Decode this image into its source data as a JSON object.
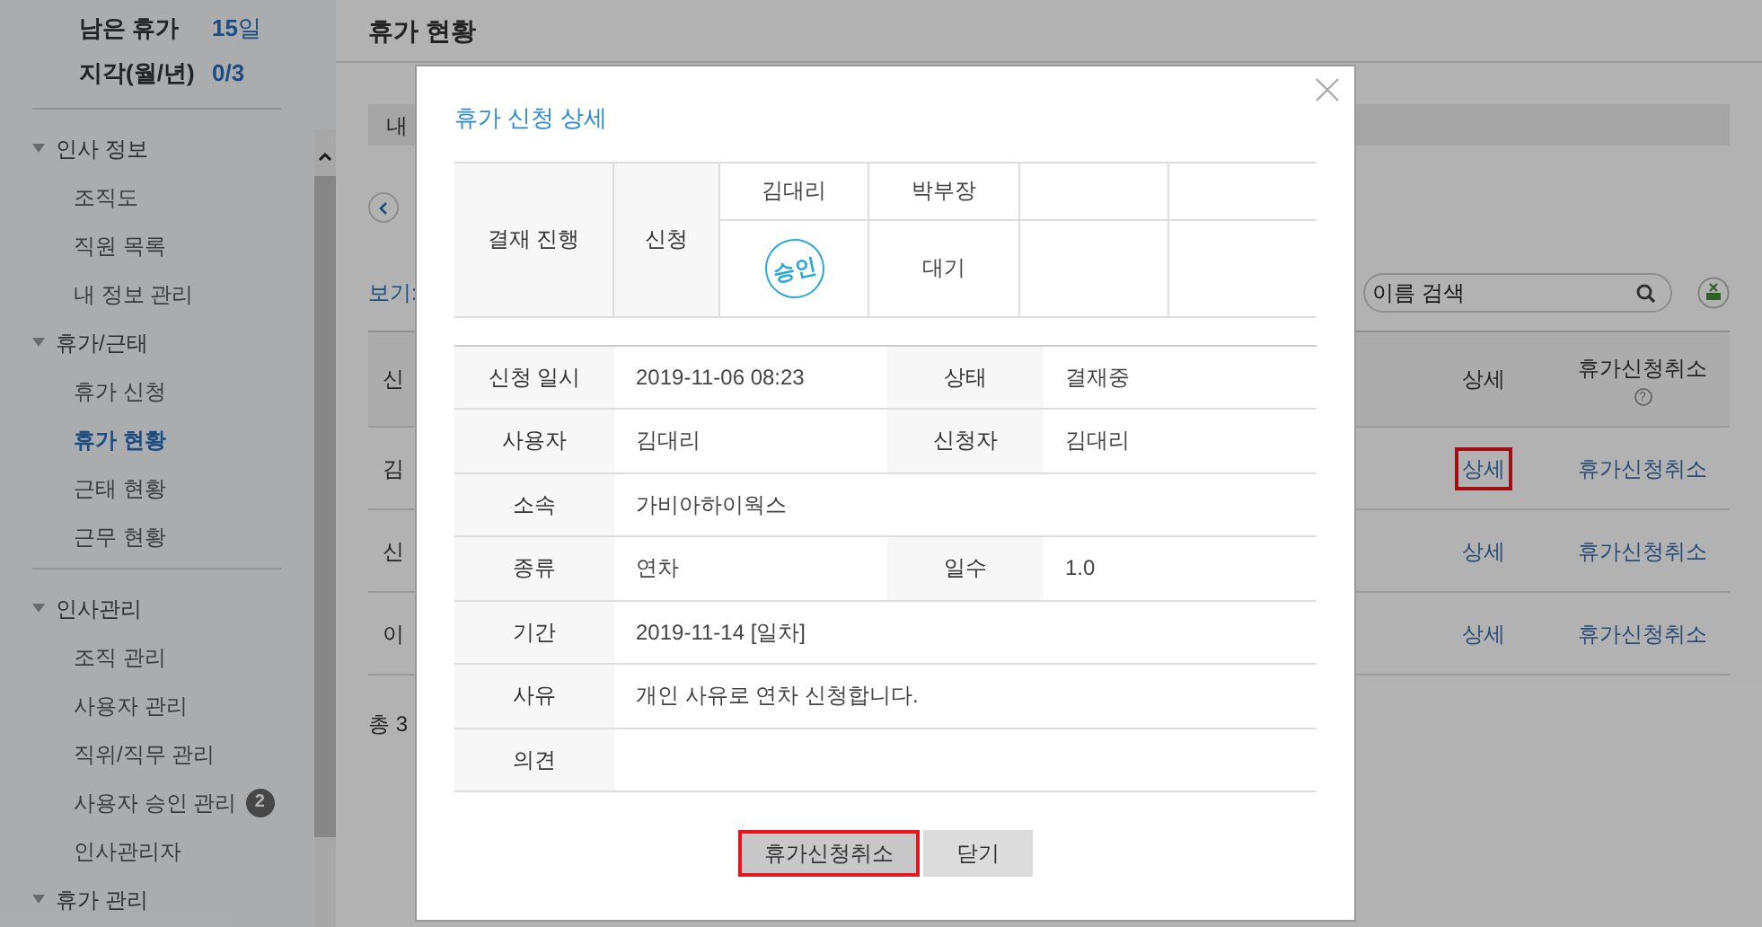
{
  "sidebar": {
    "summary": [
      {
        "label": "남은 휴가",
        "value": "15",
        "unit": "일"
      },
      {
        "label": "지각(월/년)",
        "value": "0/3"
      }
    ],
    "sections": [
      {
        "title": "인사 정보",
        "expanded": true,
        "items": [
          {
            "label": "조직도",
            "selected": false
          },
          {
            "label": "직원 목록",
            "selected": false
          },
          {
            "label": "내 정보 관리",
            "selected": false
          }
        ]
      },
      {
        "title": "휴가/근태",
        "expanded": true,
        "items": [
          {
            "label": "휴가 신청",
            "selected": false
          },
          {
            "label": "휴가 현황",
            "selected": true
          },
          {
            "label": "근태 현황",
            "selected": false
          },
          {
            "label": "근무 현황",
            "selected": false
          }
        ]
      },
      {
        "title": "인사관리",
        "expanded": true,
        "divider": true,
        "items": [
          {
            "label": "조직 관리",
            "selected": false
          },
          {
            "label": "사용자 관리",
            "selected": false
          },
          {
            "label": "직위/직무 관리",
            "selected": false
          },
          {
            "label": "사용자 승인 관리",
            "selected": false,
            "badge": "2"
          },
          {
            "label": "인사관리자",
            "selected": false
          }
        ]
      },
      {
        "title": "휴가 관리",
        "expanded": true
      }
    ]
  },
  "header": {
    "title": "휴가 현황"
  },
  "filter_bar": {
    "label": "내"
  },
  "view_label": "보기:",
  "search": {
    "placeholder": "이름 검색"
  },
  "table": {
    "columns": [
      {
        "label": "신"
      },
      {
        "label": "상세"
      },
      {
        "label": "휴가신청취소",
        "help_mark": "?"
      }
    ],
    "rows": [
      {
        "cell": "김",
        "detail": "상세",
        "detail_highlighted": true,
        "cancel": "휴가신청취소"
      },
      {
        "cell": "신",
        "detail": "상세",
        "detail_highlighted": false,
        "cancel": "휴가신청취소"
      },
      {
        "cell": "이",
        "detail": "상세",
        "detail_highlighted": false,
        "cancel": "휴가신청취소"
      }
    ],
    "total": "총 3"
  },
  "dialog": {
    "title": "휴가 신청 상세",
    "approval": {
      "label": "결재 진행",
      "step": "신청",
      "approvers": [
        {
          "name": "김대리",
          "kind": "stamp",
          "status": "승인"
        },
        {
          "name": "박부장",
          "kind": "text",
          "status": "대기"
        }
      ]
    },
    "fields": [
      {
        "cells": [
          {
            "label": "신청 일시",
            "value": "2019-11-06 08:23"
          },
          {
            "label": "상태",
            "value": "결재중"
          }
        ]
      },
      {
        "cells": [
          {
            "label": "사용자",
            "value": "김대리"
          },
          {
            "label": "신청자",
            "value": "김대리"
          }
        ]
      },
      {
        "cells": [
          {
            "label": "소속",
            "value": "가비아하이웍스"
          }
        ]
      },
      {
        "cells": [
          {
            "label": "종류",
            "value": "연차"
          },
          {
            "label": "일수",
            "value": "1.0"
          }
        ]
      },
      {
        "cells": [
          {
            "label": "기간",
            "value": "2019-11-14 [일차]"
          }
        ]
      },
      {
        "cells": [
          {
            "label": "사유",
            "value": "개인 사유로 연차 신청합니다."
          }
        ]
      },
      {
        "cells": [
          {
            "label": "의견"
          }
        ]
      }
    ],
    "buttons": [
      {
        "label": "휴가신청취소",
        "kind": "primary",
        "highlighted": true
      },
      {
        "label": "닫기",
        "kind": "secondary",
        "highlighted": false
      }
    ]
  }
}
